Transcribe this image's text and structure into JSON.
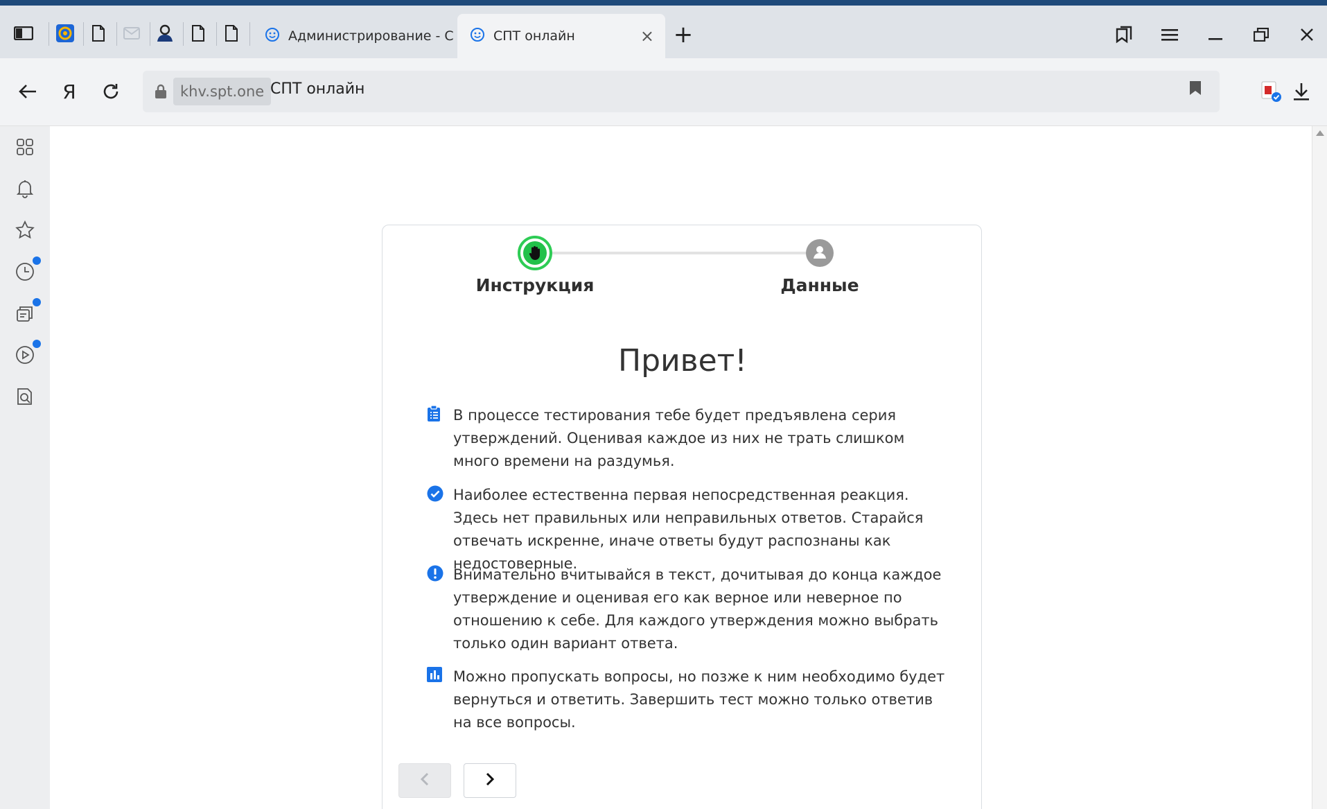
{
  "browser": {
    "tabs": [
      {
        "title": "Администрирование - СПТ",
        "active": false
      },
      {
        "title": "СПТ онлайн",
        "active": true
      }
    ],
    "new_tab_symbol": "+",
    "close_tab_symbol": "×",
    "window_controls": [
      "tab-manager-icon",
      "menu-icon",
      "minimize-icon",
      "restore-icon",
      "close-icon"
    ],
    "address": {
      "domain": "khv.spt.one",
      "page_title": "СПТ онлайн"
    },
    "yandex_letter": "Я",
    "sidebar_icons": [
      "apps-grid-icon",
      "bell-icon",
      "star-icon",
      "history-clock-icon",
      "collections-icon",
      "video-icon",
      "search-doc-icon"
    ],
    "accent_color": "#1a73e8"
  },
  "wizard": {
    "steps": [
      {
        "label": "Инструкция",
        "state": "active",
        "color": "#22c14a"
      },
      {
        "label": "Данные",
        "state": "pending",
        "color": "#9a9a9a"
      }
    ],
    "heading": "Привет!",
    "items": [
      {
        "icon": "clipboard-icon",
        "text": "В процессе тестирования тебе будет предъявлена серия утверждений. Оценивая каждое из них не трать слишком много времени на раздумья."
      },
      {
        "icon": "check-circle-icon",
        "text": "Наиболее естественна первая непосредственная реакция. Здесь нет правильных или неправильных ответов. Старайся отвечать искренне, иначе ответы будут распознаны как недостоверные."
      },
      {
        "icon": "exclamation-circle-icon",
        "text": "Внимательно вчитывайся в текст, дочитывая до конца каждое утверждение и оценивая его как верное или неверное по отношению к себе. Для каждого утверждения можно выбрать только один вариант ответа."
      },
      {
        "icon": "bar-chart-icon",
        "text": "Можно пропускать вопросы, но позже к ним необходимо будет вернуться и ответить. Завершить тест можно только ответив на все вопросы."
      }
    ],
    "icon_color": "#1a73e8",
    "prev_enabled": false,
    "next_enabled": true
  }
}
